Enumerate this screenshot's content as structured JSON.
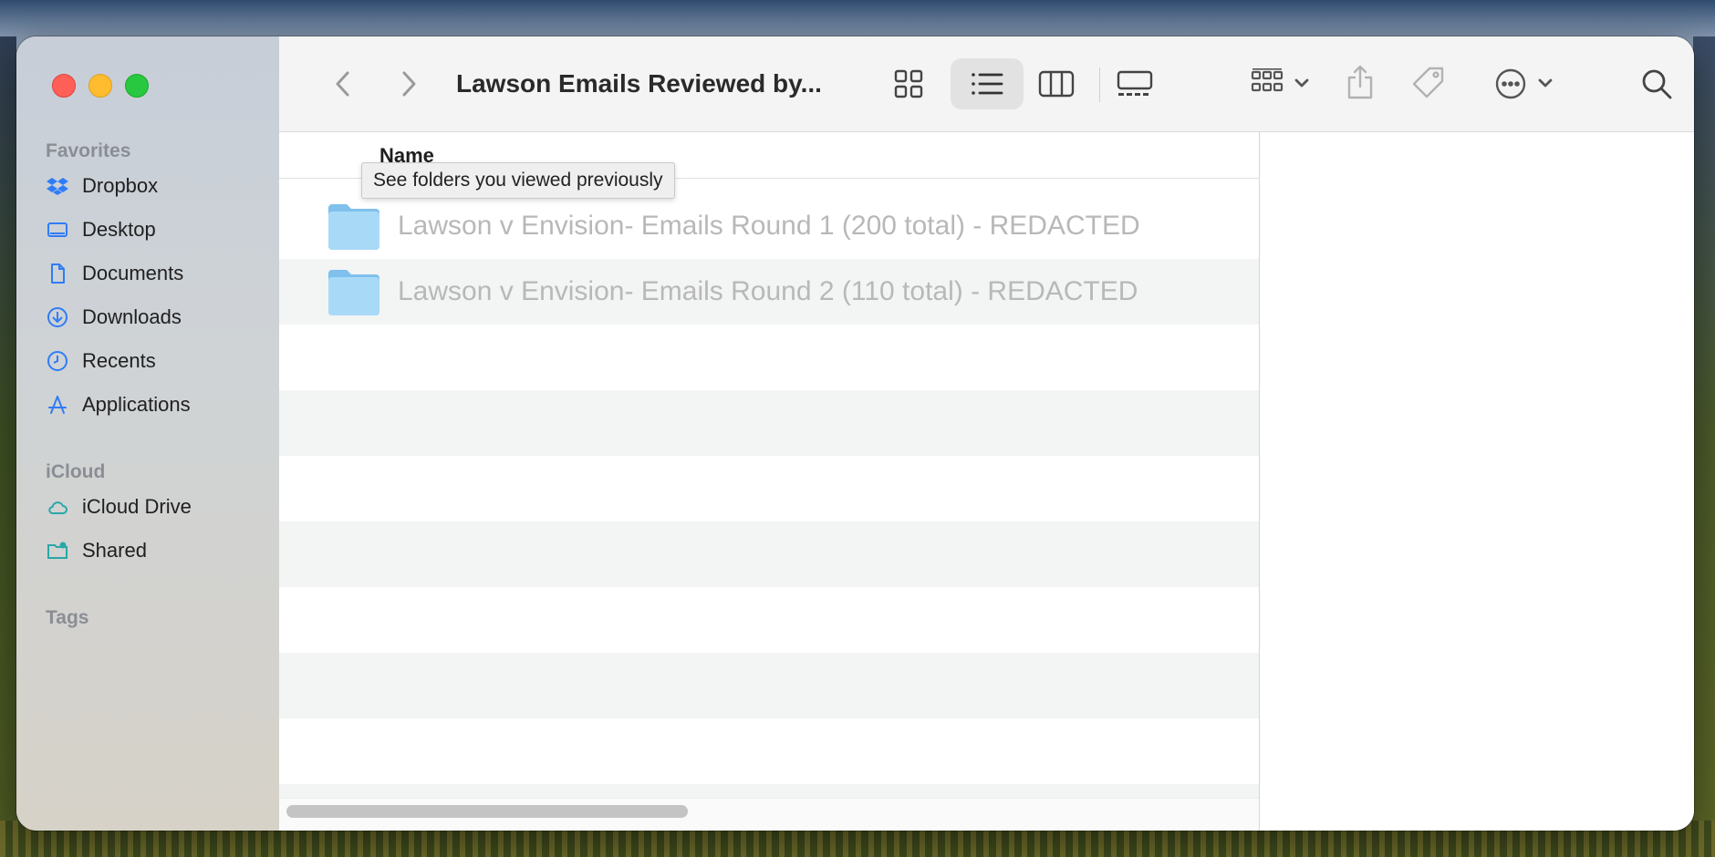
{
  "window": {
    "title": "Lawson Emails Reviewed by..."
  },
  "sidebar": {
    "favorites_label": "Favorites",
    "favorites": [
      {
        "label": "Dropbox",
        "icon": "dropbox-icon"
      },
      {
        "label": "Desktop",
        "icon": "desktop-icon"
      },
      {
        "label": "Documents",
        "icon": "document-icon"
      },
      {
        "label": "Downloads",
        "icon": "download-icon"
      },
      {
        "label": "Recents",
        "icon": "clock-icon"
      },
      {
        "label": "Applications",
        "icon": "applications-icon"
      }
    ],
    "icloud_label": "iCloud",
    "icloud": [
      {
        "label": "iCloud Drive",
        "icon": "cloud-icon"
      },
      {
        "label": "Shared",
        "icon": "shared-folder-icon"
      }
    ],
    "tags_label": "Tags"
  },
  "toolbar": {
    "icons": [
      "back-icon",
      "forward-icon",
      "icon-view-icon",
      "list-view-icon",
      "column-view-icon",
      "gallery-view-icon",
      "group-icon",
      "share-icon",
      "tag-icon",
      "more-actions-icon",
      "search-icon"
    ],
    "active_view": "list"
  },
  "content": {
    "column_header": "Name",
    "tooltip": "See folders you viewed previously",
    "files": [
      {
        "name": "Lawson v Envision- Emails Round 1 (200 total) - REDACTED",
        "kind": "folder"
      },
      {
        "name": "Lawson v Envision- Emails Round 2 (110 total) - REDACTED",
        "kind": "folder"
      }
    ]
  },
  "colors": {
    "accent": "#2f7cf6",
    "close": "#fe5f57",
    "minimize": "#febc2e",
    "maximize": "#28c840",
    "folder": "#9fd3f6"
  }
}
